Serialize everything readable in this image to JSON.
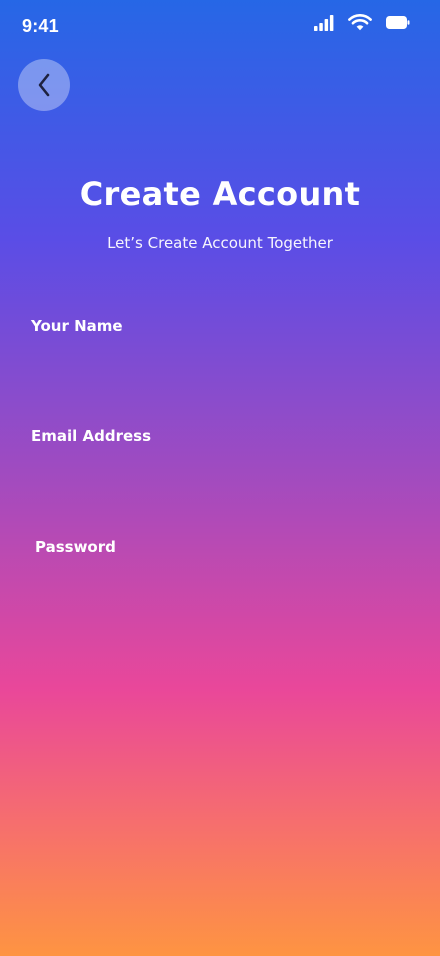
{
  "status_bar": {
    "time": "9:41",
    "icons": [
      "cellular-signal-icon",
      "wifi-icon",
      "battery-icon"
    ]
  },
  "header": {
    "back_icon": "chevron-left-icon",
    "title": "Create Account",
    "subtitle": "Let’s Create Account Together"
  },
  "form": {
    "name_label": "Your Name",
    "name_value": "",
    "email_label": "Email Address",
    "email_value": "",
    "password_label": "Password",
    "password_value": ""
  },
  "colors": {
    "gradient_top": "#2667e6",
    "gradient_mid": "#a24bbf",
    "gradient_pink": "#e9479a",
    "gradient_bottom": "#fe9442",
    "text": "#ffffff"
  }
}
